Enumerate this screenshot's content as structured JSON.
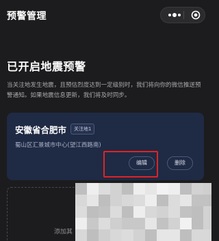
{
  "header": {
    "title": "预警管理",
    "more_icon": "more-dots-icon",
    "target_icon": "target-circle-icon"
  },
  "main": {
    "heading": "已开启地震预警",
    "description": "当关注地发生地震，且预估烈度达到一定级别时，我们将向你的微信推送预警通知。如果地震信息更新，我们将及时同步。"
  },
  "card": {
    "city": "安徽省合肥市",
    "tag": "关注地1",
    "address": "蜀山区汇景城市中心(望江西路南)",
    "edit_label": "编辑",
    "delete_label": "删除"
  },
  "add": {
    "label": "添加其"
  },
  "colors": {
    "background": "#1c1c1e",
    "card": "#1f2a44",
    "highlight": "#e02424"
  }
}
